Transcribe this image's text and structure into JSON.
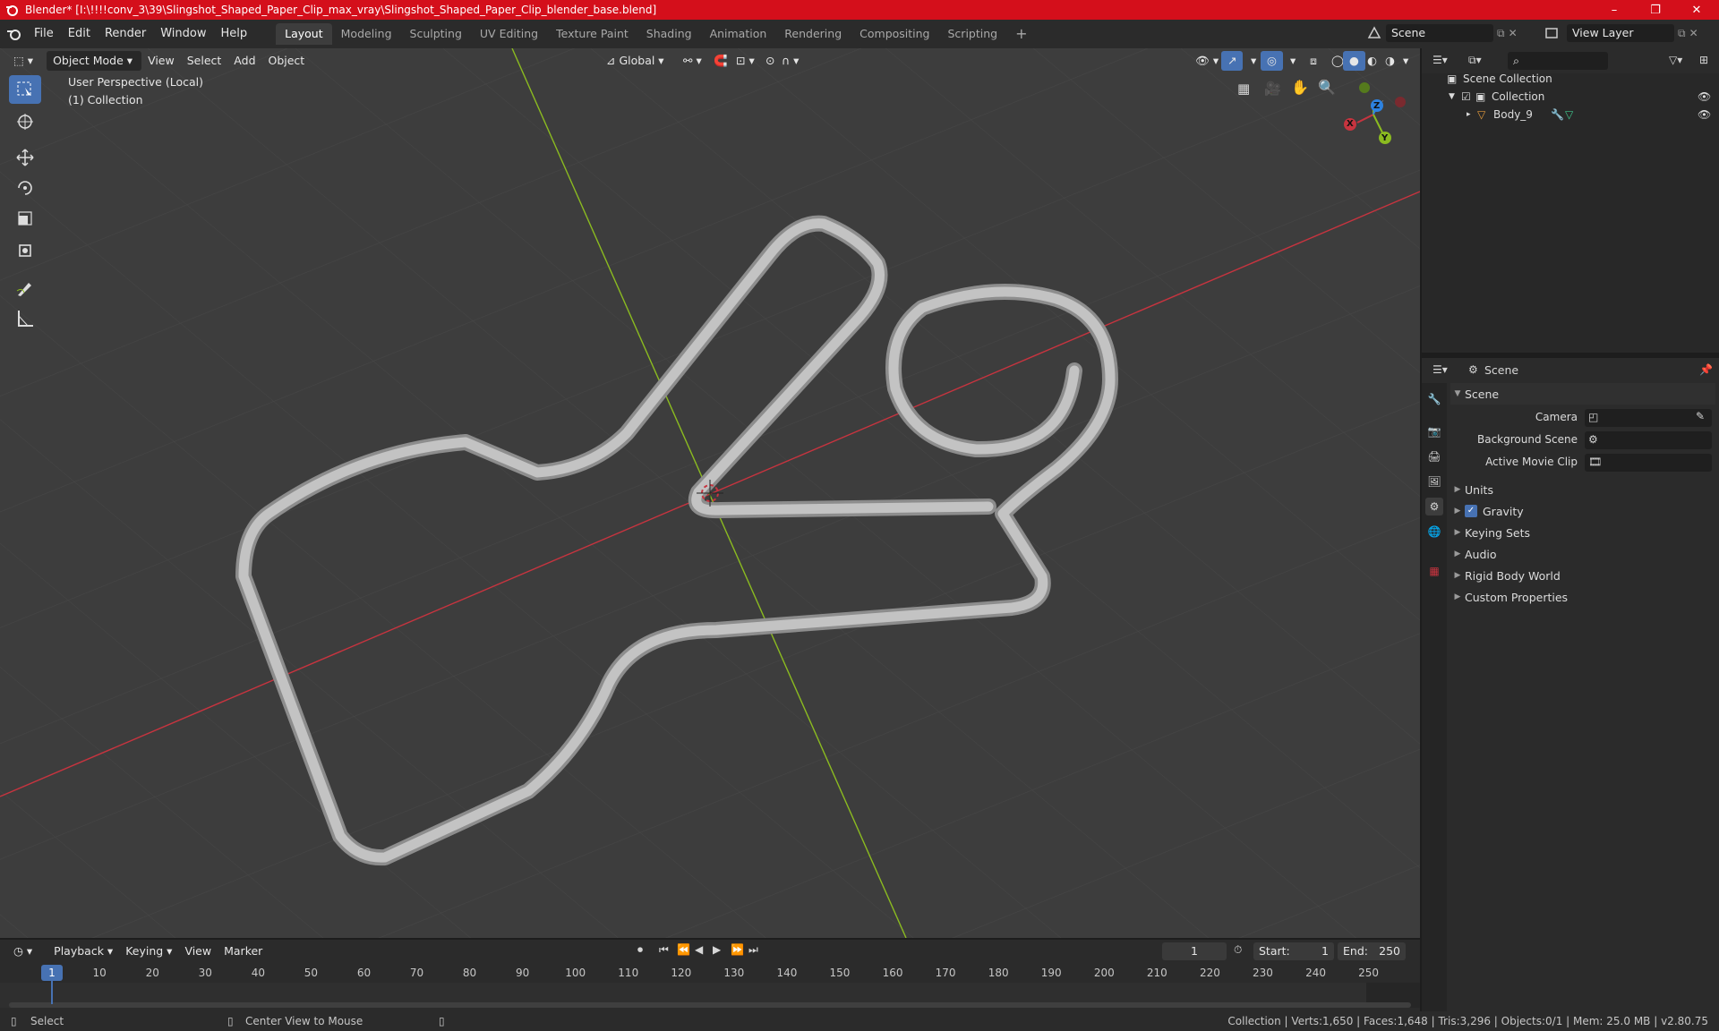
{
  "window": {
    "title": "Blender* [I:\\!!!!conv_3\\39\\Slingshot_Shaped_Paper_Clip_max_vray\\Slingshot_Shaped_Paper_Clip_blender_base.blend]",
    "minimize": "–",
    "maximize": "❐",
    "close": "✕"
  },
  "menu": [
    "File",
    "Edit",
    "Render",
    "Window",
    "Help"
  ],
  "workspaces": [
    "Layout",
    "Modeling",
    "Sculpting",
    "UV Editing",
    "Texture Paint",
    "Shading",
    "Animation",
    "Rendering",
    "Compositing",
    "Scripting"
  ],
  "active_workspace": "Layout",
  "scene_field": "Scene",
  "view_layer_field": "View Layer",
  "viewport_header": {
    "mode": "Object Mode",
    "menus": [
      "View",
      "Select",
      "Add",
      "Object"
    ],
    "orientation": "Global"
  },
  "viewport_overlay": {
    "perspective": "User Perspective (Local)",
    "collection": "(1) Collection"
  },
  "gizmo": {
    "x": "X",
    "y": "Y",
    "z": "Z"
  },
  "outliner": {
    "items": [
      {
        "label": "Scene Collection"
      },
      {
        "label": "Collection"
      },
      {
        "label": "Body_9"
      }
    ]
  },
  "properties": {
    "header": "Scene",
    "panel_title": "Scene",
    "camera_label": "Camera",
    "background_scene_label": "Background Scene",
    "active_movie_clip_label": "Active Movie Clip",
    "panels": [
      "Units",
      "Gravity",
      "Keying Sets",
      "Audio",
      "Rigid Body World",
      "Custom Properties"
    ]
  },
  "timeline": {
    "menus": [
      "Playback",
      "Keying",
      "View",
      "Marker"
    ],
    "current_frame": "1",
    "start_label": "Start:",
    "start_value": "1",
    "end_label": "End:",
    "end_value": "250",
    "ticks": [
      "1",
      "10",
      "20",
      "30",
      "40",
      "50",
      "60",
      "70",
      "80",
      "90",
      "100",
      "110",
      "120",
      "130",
      "140",
      "150",
      "160",
      "170",
      "180",
      "190",
      "200",
      "210",
      "220",
      "230",
      "240",
      "250"
    ]
  },
  "statusbar": {
    "select": "Select",
    "center_view": "Center View to Mouse",
    "stats": "Collection | Verts:1,650 | Faces:1,648 | Tris:3,296 | Objects:0/1 | Mem: 25.0 MB | v2.80.75"
  },
  "colors": {
    "accent": "#4772b3",
    "title_bar": "#d40f1b",
    "x_axis": "#c7343f",
    "y_axis": "#8bbb20",
    "z_axis": "#2d82e0"
  }
}
